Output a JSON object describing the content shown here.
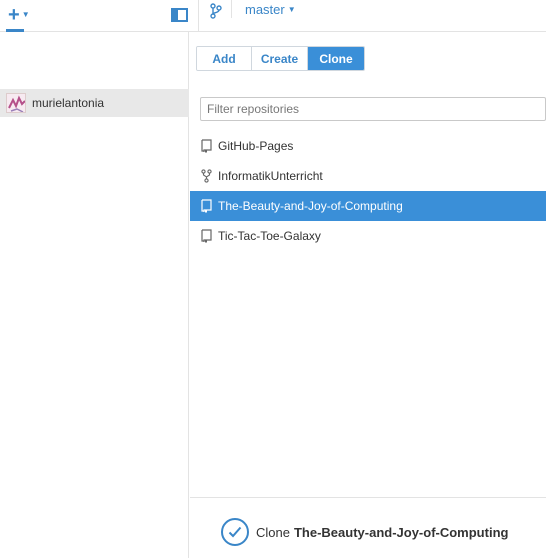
{
  "header": {
    "add_icon": "plus-icon",
    "panel_icon": "sidebar-toggle-icon",
    "branch_icon": "git-branch-icon",
    "branch": "master",
    "accent": "#3a86c8"
  },
  "sidebar": {
    "account": {
      "name": "murielantonia",
      "avatar_icon": "user-avatar"
    }
  },
  "tabs": [
    {
      "label": "Add",
      "selected": false
    },
    {
      "label": "Create",
      "selected": false
    },
    {
      "label": "Clone",
      "selected": true
    }
  ],
  "filter": {
    "placeholder": "Filter repositories",
    "value": ""
  },
  "repositories": [
    {
      "name": "GitHub-Pages",
      "icon": "repo-icon",
      "selected": false
    },
    {
      "name": "InformatikUnterricht",
      "icon": "fork-icon",
      "selected": false
    },
    {
      "name": "The-Beauty-and-Joy-of-Computing",
      "icon": "repo-icon",
      "selected": true
    },
    {
      "name": "Tic-Tac-Toe-Galaxy",
      "icon": "repo-icon",
      "selected": false
    }
  ],
  "footer": {
    "verb": "Clone",
    "target": "The-Beauty-and-Joy-of-Computing",
    "icon": "check-circle-icon"
  },
  "colors": {
    "selection": "#3a8fd8",
    "sidebar_selected": "#e8e8e8"
  }
}
